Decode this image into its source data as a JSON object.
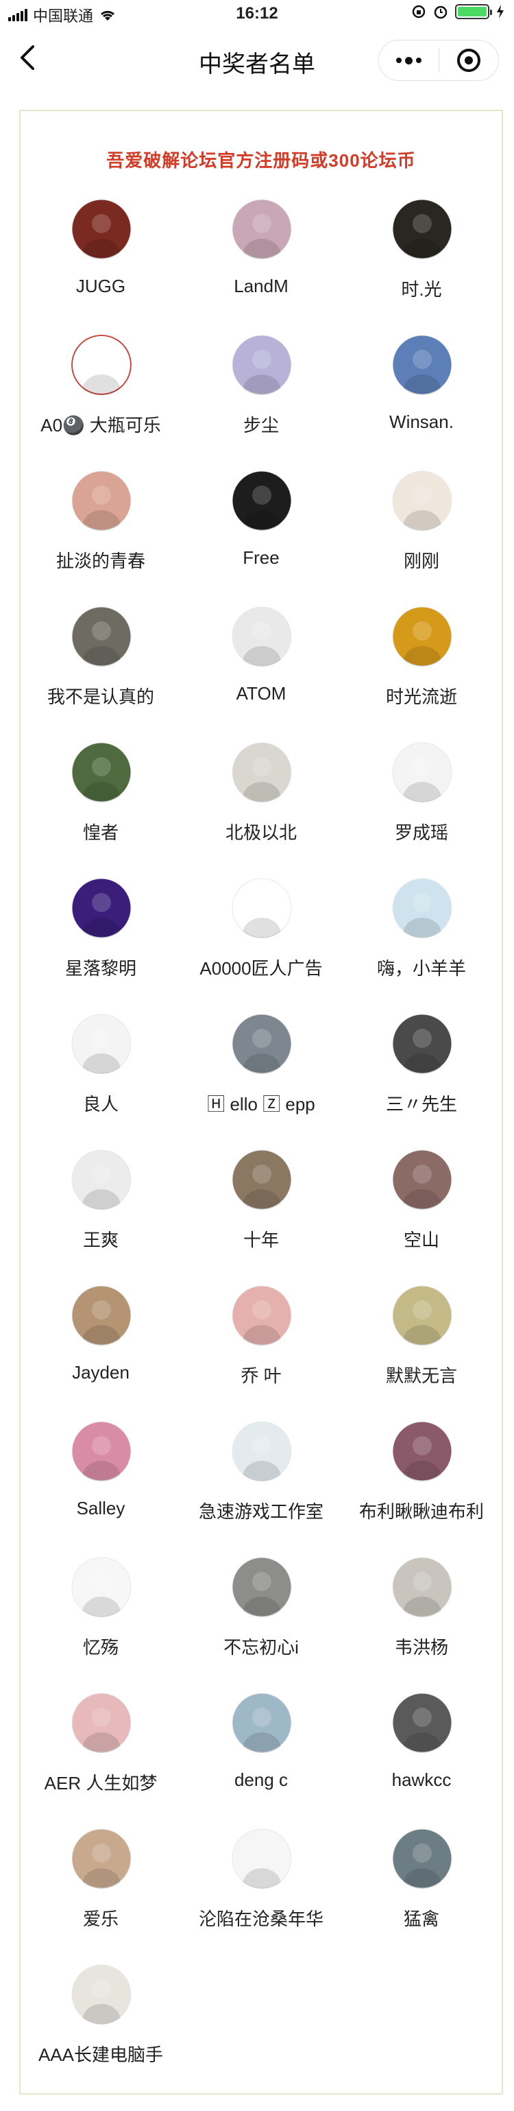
{
  "status_bar": {
    "carrier": "中国联通",
    "time": "16:12"
  },
  "nav": {
    "title": "中奖者名单"
  },
  "announcement": {
    "prize_text": "吾爱破解论坛官方注册码或300论坛币"
  },
  "winners": [
    {
      "name": "JUGG",
      "avatar_color": "#7a2a20"
    },
    {
      "name": "LandM",
      "avatar_color": "#c9a7b6"
    },
    {
      "name": "时.光",
      "avatar_color": "#2a2722"
    },
    {
      "name": "A0🎱 大瓶可乐",
      "avatar_color": "#ffffff",
      "avatar_border": "#c8463c"
    },
    {
      "name": "步尘",
      "avatar_color": "#b8b2d8"
    },
    {
      "name": "Winsan.",
      "avatar_color": "#5d7fb8"
    },
    {
      "name": "扯淡的青春",
      "avatar_color": "#d9a494"
    },
    {
      "name": "Free",
      "avatar_color": "#1d1d1d"
    },
    {
      "name": "刚刚",
      "avatar_color": "#efe6dc"
    },
    {
      "name": "我不是认真的",
      "avatar_color": "#6e6c62"
    },
    {
      "name": "ATOM",
      "avatar_color": "#e9e9e9"
    },
    {
      "name": "时光流逝",
      "avatar_color": "#d69a1a"
    },
    {
      "name": "惶者",
      "avatar_color": "#4e6a3e"
    },
    {
      "name": "北极以北",
      "avatar_color": "#dad6d0"
    },
    {
      "name": "罗成瑶",
      "avatar_color": "#f4f4f4"
    },
    {
      "name": "星落黎明",
      "avatar_color": "#3a1e7a"
    },
    {
      "name": "A0000匠人广告",
      "avatar_color": "#ffffff"
    },
    {
      "name": "嗨，小羊羊",
      "avatar_color": "#cfe3ee"
    },
    {
      "name": "良人",
      "avatar_color": "#f4f4f4"
    },
    {
      "name": "🄷 ello 🅉 epp",
      "avatar_color": "#7e8790"
    },
    {
      "name": "三〃先生",
      "avatar_color": "#4a4a4a"
    },
    {
      "name": "王爽",
      "avatar_color": "#ececec"
    },
    {
      "name": "十年",
      "avatar_color": "#8a7862"
    },
    {
      "name": "空山",
      "avatar_color": "#8c6a66"
    },
    {
      "name": "Jayden",
      "avatar_color": "#b59474"
    },
    {
      "name": "乔 叶",
      "avatar_color": "#e4b1ae"
    },
    {
      "name": "默默无言",
      "avatar_color": "#c4ba88"
    },
    {
      "name": "Salley",
      "avatar_color": "#d98ca6"
    },
    {
      "name": "急速游戏工作室",
      "avatar_color": "#e3ebef"
    },
    {
      "name": "布利瞅瞅迪布利",
      "avatar_color": "#8a5a6a"
    },
    {
      "name": "忆殇",
      "avatar_color": "#f7f7f7"
    },
    {
      "name": "不忘初心i",
      "avatar_color": "#8d8d8b"
    },
    {
      "name": "韦洪杨",
      "avatar_color": "#c9c4bd"
    },
    {
      "name": "AER 人生如梦",
      "avatar_color": "#e7b9ba"
    },
    {
      "name": "deng c",
      "avatar_color": "#9fb8c8"
    },
    {
      "name": "hawkcc",
      "avatar_color": "#5a5a5a"
    },
    {
      "name": "爱乐",
      "avatar_color": "#c9a98e"
    },
    {
      "name": "沦陷在沧桑年华",
      "avatar_color": "#f6f6f6"
    },
    {
      "name": "猛禽",
      "avatar_color": "#6d7d84"
    },
    {
      "name": "AAA长建电脑手",
      "avatar_color": "#e8e4de"
    }
  ]
}
